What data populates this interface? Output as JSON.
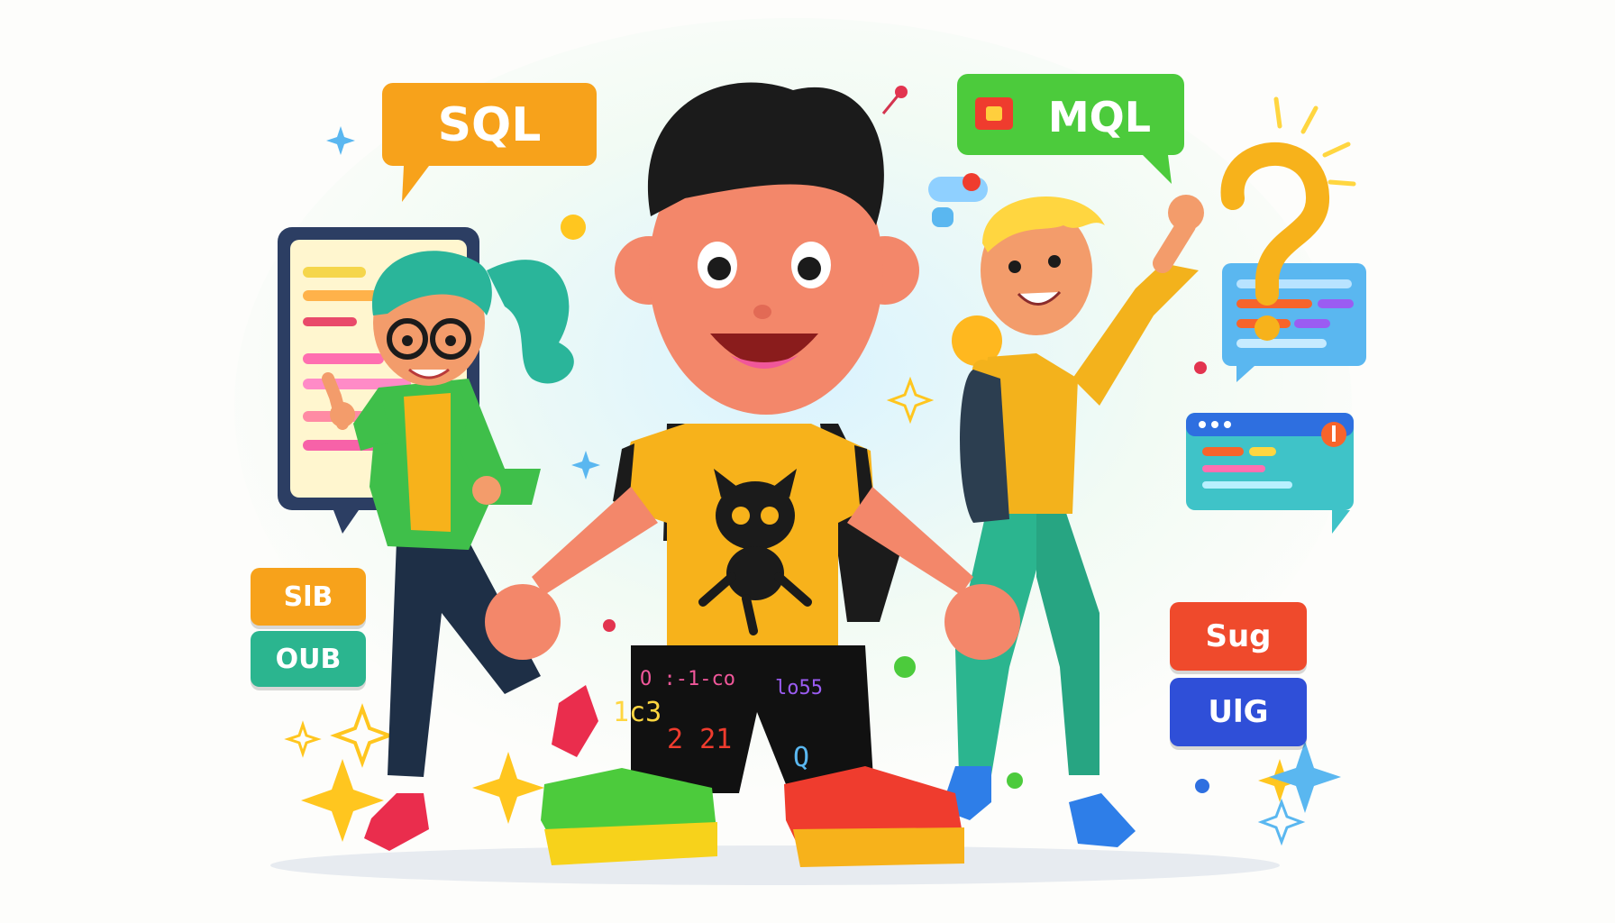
{
  "bubbles": {
    "left": "SQL",
    "right": "MQL"
  },
  "tags_left": [
    "SlB",
    "OUB"
  ],
  "tags_right": [
    "Sug",
    "UlG"
  ],
  "pants_code": [
    "O :-1-co",
    "1c3",
    "2 21",
    "lo55",
    "Q"
  ],
  "colors": {
    "sql_bubble": "#f7a21b",
    "mql_bubble": "#4ccb3c",
    "tag_orange": "#f7a21b",
    "tag_green": "#2bb58f",
    "tag_red": "#ef4a2c",
    "tag_blue": "#2f4fd8",
    "shirt_main": "#f7b21b",
    "shirt_right": "#f3b21c",
    "jacket_left": "#3fbf4a"
  },
  "icons": [
    "cat-logo-icon",
    "question-mark-icon",
    "sparkle-icon",
    "pin-icon",
    "code-window-icon",
    "chat-card-icon"
  ]
}
